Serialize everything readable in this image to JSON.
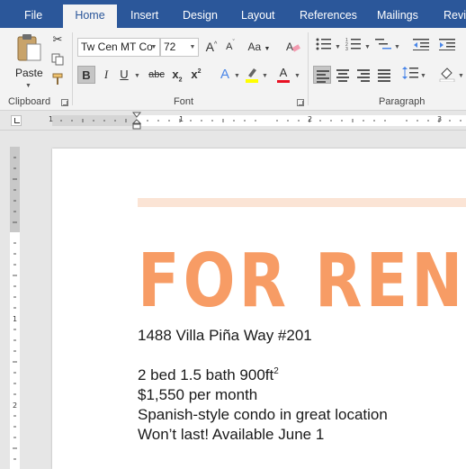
{
  "tabs": [
    {
      "label": "File"
    },
    {
      "label": "Home"
    },
    {
      "label": "Insert"
    },
    {
      "label": "Design"
    },
    {
      "label": "Layout"
    },
    {
      "label": "References"
    },
    {
      "label": "Mailings"
    },
    {
      "label": "Revi"
    }
  ],
  "ribbon": {
    "clipboard": {
      "paste_label": "Paste",
      "group_label": "Clipboard"
    },
    "font": {
      "font_name": "Tw Cen MT Co",
      "font_size": "72",
      "group_label": "Font",
      "bold": "B",
      "italic": "I",
      "underline": "U",
      "strikethrough": "abc",
      "subscript": "x",
      "subscript_suffix": "2",
      "superscript": "x",
      "superscript_suffix": "2",
      "grow": "A",
      "shrink": "A",
      "change_case": "Aa",
      "text_effects": "A",
      "font_color": "A"
    },
    "paragraph": {
      "group_label": "Paragraph"
    }
  },
  "ruler": {
    "labels": [
      "1",
      "1",
      "2",
      "3"
    ]
  },
  "vruler": {
    "labels": [
      "1",
      "2"
    ]
  },
  "document": {
    "title": "FOR RENT",
    "address": "1488 Villa Piña Way #201",
    "details": "2 bed 1.5 bath 900ft",
    "details_sup": "2",
    "price": "$1,550 per month",
    "description": "Spanish-style condo in great location",
    "availability": "Won’t last! Available June 1"
  },
  "colors": {
    "title_bar": "#2b579a",
    "accent": "#f79c65",
    "accent_light": "#fbe4d5",
    "highlight_yellow": "#ffff00",
    "font_color_red": "#e81123"
  }
}
